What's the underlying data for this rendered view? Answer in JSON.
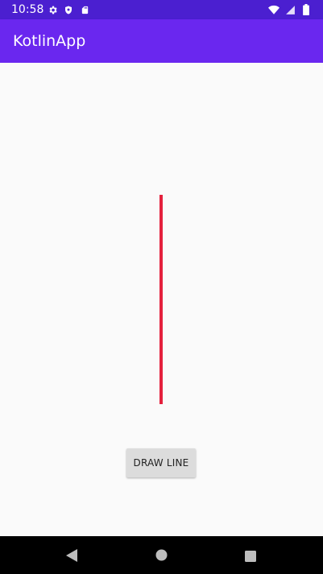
{
  "status_bar": {
    "time": "10:58",
    "background": "#4b1fd0",
    "icons_left": [
      "settings-gear-icon",
      "shield-icon",
      "sd-card-icon"
    ],
    "icons_right": [
      "wifi-icon",
      "cellular-signal-icon",
      "battery-icon"
    ]
  },
  "app_bar": {
    "title": "KotlinApp",
    "background": "#6a27ef"
  },
  "drawing": {
    "line_color": "#e4213d"
  },
  "button": {
    "label": "DRAW LINE"
  },
  "nav_bar": {
    "icons": [
      "back-icon",
      "home-icon",
      "recents-icon"
    ]
  }
}
